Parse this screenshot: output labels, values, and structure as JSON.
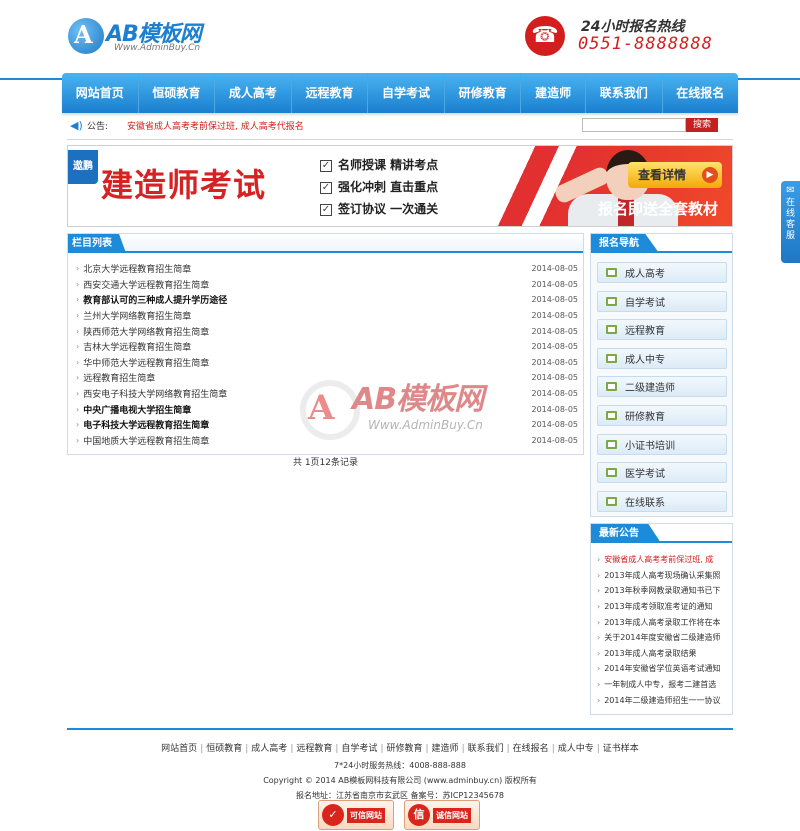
{
  "header": {
    "logo_mark": "A",
    "logo_text": "AB模板网",
    "logo_subtitle": "Www.AdminBuy.Cn",
    "hotline_label": "24小时报名热线",
    "hotline_number": "0551-8888888"
  },
  "nav": {
    "items": [
      "网站首页",
      "恒硕教育",
      "成人高考",
      "远程教育",
      "自学考试",
      "研修教育",
      "建造师",
      "联系我们",
      "在线报名"
    ]
  },
  "notice": {
    "label": "公告:",
    "text": "安徽省成人高考考前保过班, 成人高考代报名",
    "search_placeholder": "",
    "search_button": "搜索"
  },
  "banner": {
    "tag": "遨鹏",
    "title": "建造师考试",
    "points": [
      "名师授课  精讲考点",
      "强化冲刺  直击重点",
      "签订协议  一次通关"
    ],
    "button": "查看详情",
    "slogan": "报名即送全套教材"
  },
  "column_list": {
    "heading": "栏目列表",
    "items": [
      {
        "title": "北京大学远程教育招生简章",
        "date": "2014-08-05",
        "bold": false
      },
      {
        "title": "西安交通大学远程教育招生简章",
        "date": "2014-08-05",
        "bold": false
      },
      {
        "title": "教育部认可的三种成人提升学历途径",
        "date": "2014-08-05",
        "bold": true
      },
      {
        "title": "兰州大学网络教育招生简章",
        "date": "2014-08-05",
        "bold": false
      },
      {
        "title": "陕西师范大学网络教育招生简章",
        "date": "2014-08-05",
        "bold": false
      },
      {
        "title": "吉林大学远程教育招生简章",
        "date": "2014-08-05",
        "bold": false
      },
      {
        "title": "华中师范大学远程教育招生简章",
        "date": "2014-08-05",
        "bold": false
      },
      {
        "title": "远程教育招生简章",
        "date": "2014-08-05",
        "bold": false
      },
      {
        "title": "西安电子科技大学网络教育招生简章",
        "date": "2014-08-05",
        "bold": false
      },
      {
        "title": "中央广播电视大学招生简章",
        "date": "2014-08-05",
        "bold": true
      },
      {
        "title": "电子科技大学远程教育招生简章",
        "date": "2014-08-05",
        "bold": true
      },
      {
        "title": "中国地质大学远程教育招生简章",
        "date": "2014-08-05",
        "bold": false
      }
    ],
    "pagination": "共 1页12条记录"
  },
  "watermark": {
    "mark": "A",
    "text": "AB模板网",
    "sub": "Www.AdminBuy.Cn"
  },
  "sidebar_nav": {
    "heading": "报名导航",
    "items": [
      "成人高考",
      "自学考试",
      "远程教育",
      "成人中专",
      "二级建造师",
      "研修教育",
      "小证书培训",
      "医学考试",
      "在线联系"
    ]
  },
  "news": {
    "heading": "最新公告",
    "items": [
      {
        "text": "安徽省成人高考考前保过班, 成",
        "red": true
      },
      {
        "text": "2013年成人高考现场确认采集照",
        "red": false
      },
      {
        "text": "2013年秋季网教录取通知书已下",
        "red": false
      },
      {
        "text": "2013年成考领取准考证的通知",
        "red": false
      },
      {
        "text": "2013年成人高考录取工作将在本",
        "red": false
      },
      {
        "text": "关于2014年度安徽省二级建造师",
        "red": false
      },
      {
        "text": "2013年成人高考录取结果",
        "red": false
      },
      {
        "text": "2014年安徽省学位英语考试通知",
        "red": false
      },
      {
        "text": "一年制成人中专，报考二建首选",
        "red": false
      },
      {
        "text": "2014年二级建造师招生一一协议",
        "red": false
      }
    ]
  },
  "float_tab": {
    "icon": "chat-icon",
    "text": "在线客服"
  },
  "footer": {
    "links": [
      "网站首页",
      "恒硕教育",
      "成人高考",
      "远程教育",
      "自学考试",
      "研修教育",
      "建造师",
      "联系我们",
      "在线报名",
      "成人中专",
      "证书样本"
    ],
    "service": "7*24小时服务热线：4008-888-888",
    "copyright": "Copyright © 2014 AB模板网科技有限公司  (www.adminbuy.cn) 版权所有",
    "address": "报名地址：江苏省南京市玄武区  备案号：苏ICP12345678",
    "badge1": "可信网站",
    "badge2": "诚信网站"
  },
  "colors": {
    "brand_blue": "#1c8bd9",
    "accent_red": "#d21b1b"
  }
}
